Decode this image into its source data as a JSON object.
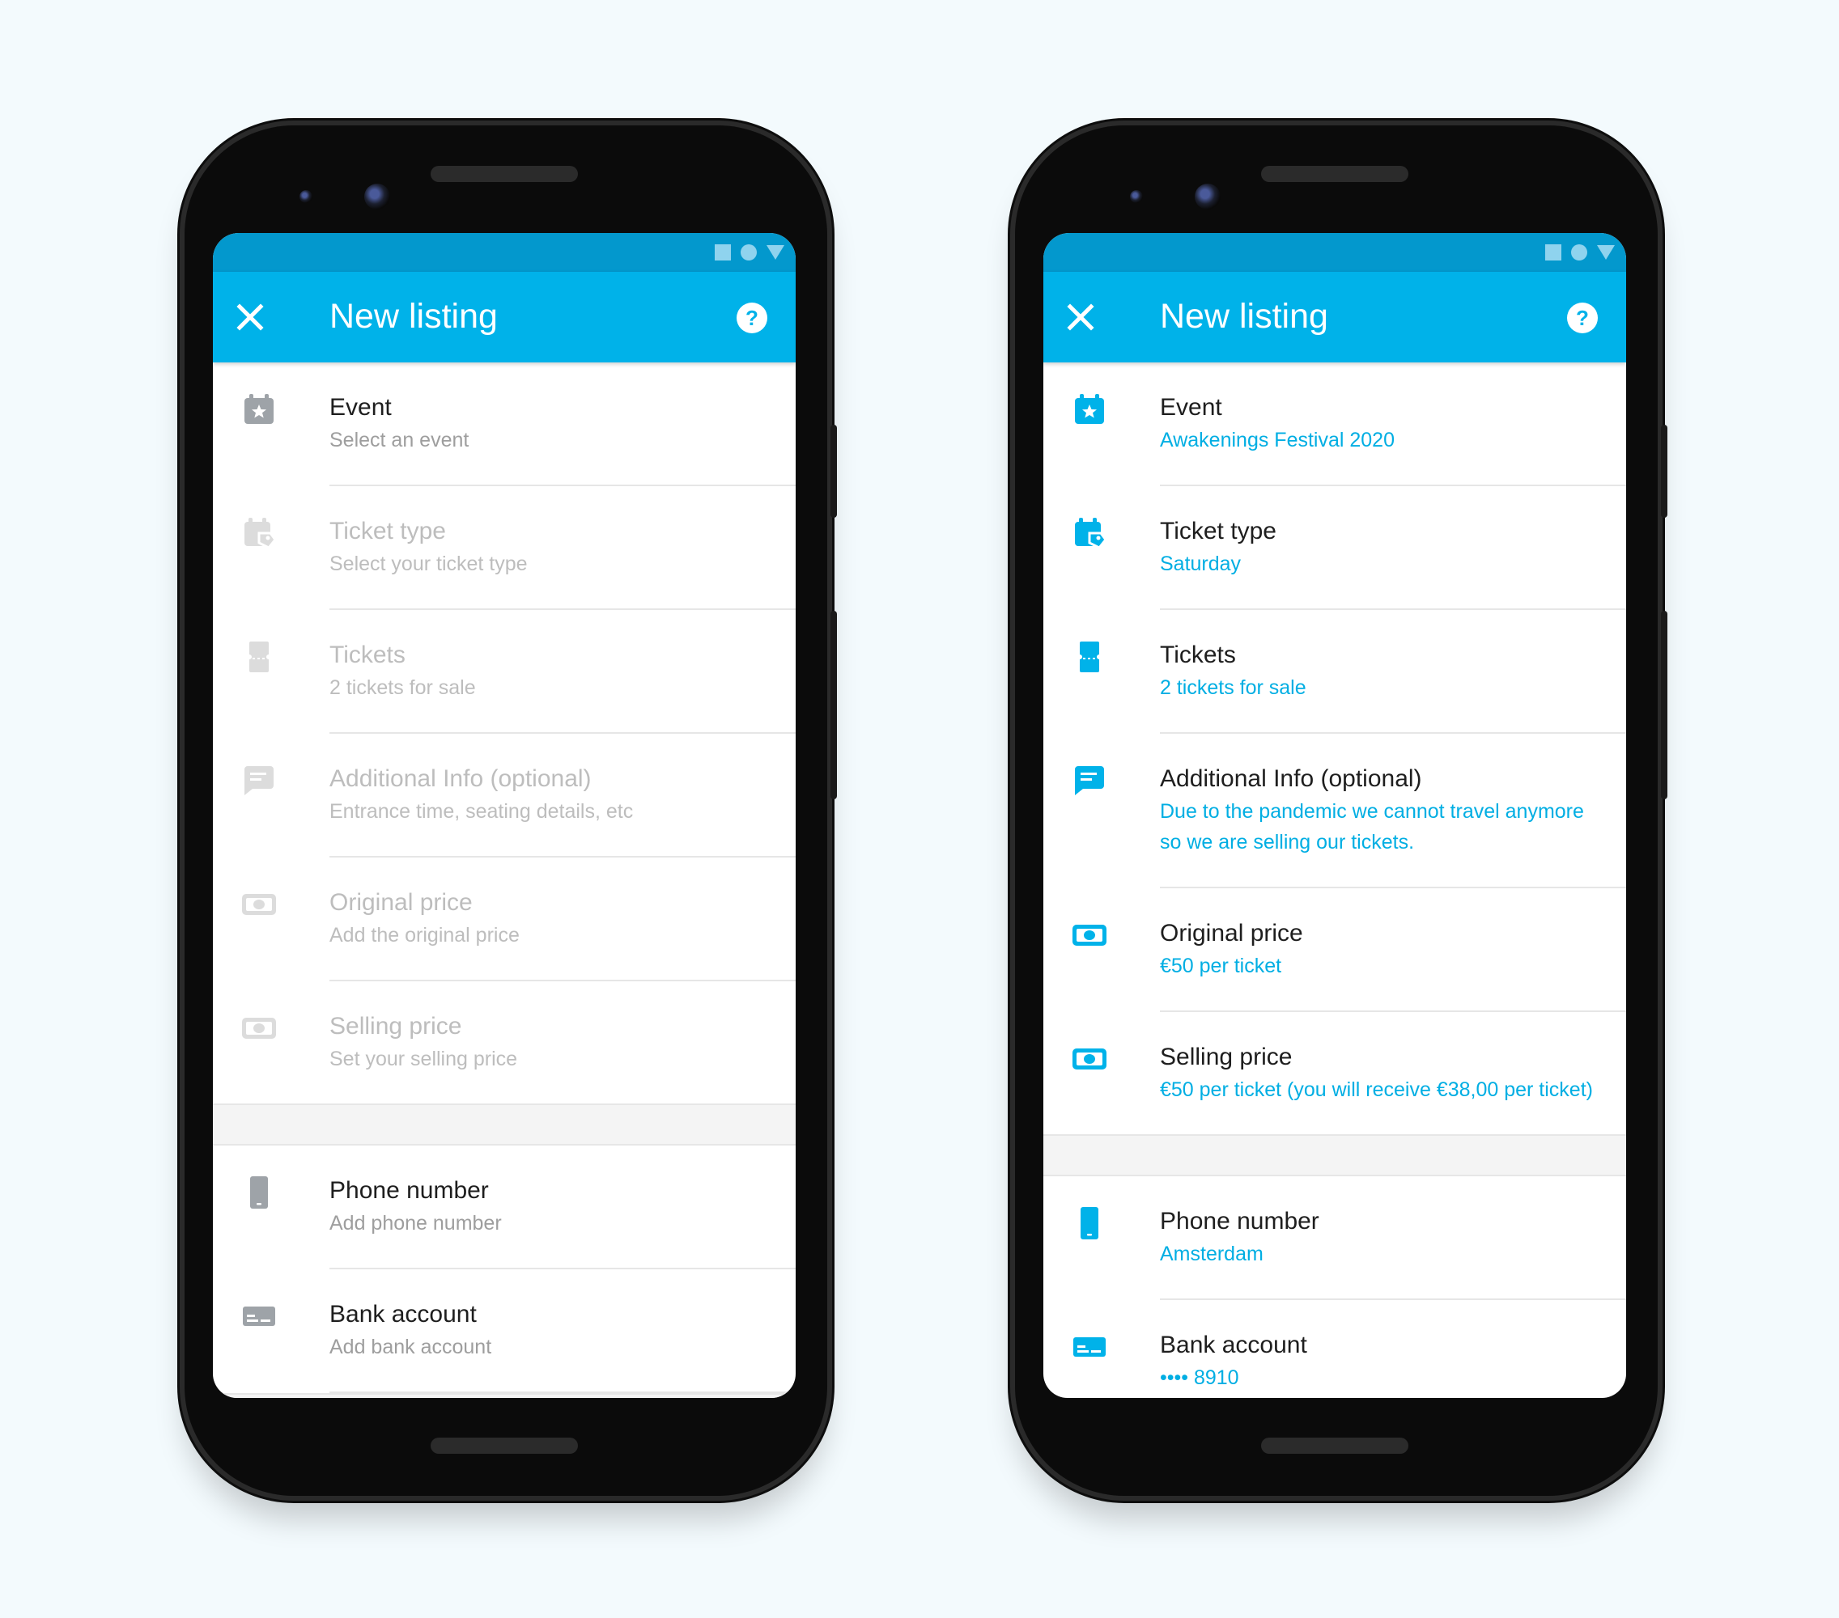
{
  "phones": [
    {
      "app_title": "New listing",
      "rows": [
        {
          "title": "Event",
          "sub": "Select an event"
        },
        {
          "title": "Ticket type",
          "sub": "Select your ticket type"
        },
        {
          "title": "Tickets",
          "sub": "2 tickets for sale"
        },
        {
          "title": "Additional Info (optional)",
          "sub": "Entrance time, seating details, etc"
        },
        {
          "title": "Original price",
          "sub": "Add the original price"
        },
        {
          "title": "Selling price",
          "sub": "Set your selling price"
        },
        {
          "title": "Phone number",
          "sub": "Add phone number"
        },
        {
          "title": "Bank account",
          "sub": "Add bank account"
        }
      ]
    },
    {
      "app_title": "New listing",
      "rows": [
        {
          "title": "Event",
          "sub": "Awakenings Festival 2020"
        },
        {
          "title": "Ticket type",
          "sub": "Saturday"
        },
        {
          "title": "Tickets",
          "sub": "2 tickets for sale"
        },
        {
          "title": "Additional Info (optional)",
          "sub": "Due to the pandemic we cannot travel anymore so we are selling our tickets."
        },
        {
          "title": "Original price",
          "sub": "€50 per ticket"
        },
        {
          "title": "Selling price",
          "sub": "€50 per ticket (you will receive €38,00 per ticket)"
        },
        {
          "title": "Phone number",
          "sub": "Amsterdam"
        },
        {
          "title": "Bank account",
          "sub": "•••• 8910"
        }
      ]
    }
  ],
  "icons": {
    "close": "close-icon",
    "help": "help-icon",
    "event": "calendar-star-icon",
    "ticket_type": "calendar-tag-icon",
    "tickets": "ticket-icon",
    "info": "chat-icon",
    "price": "money-icon",
    "phone": "phone-icon",
    "bank": "card-icon"
  },
  "colors": {
    "brand": "#00b2e9",
    "statusbar": "#0398cd",
    "accent_text": "#00aee3",
    "icon_gray": "#9ea3a8",
    "icon_light": "#dcdcdc"
  }
}
